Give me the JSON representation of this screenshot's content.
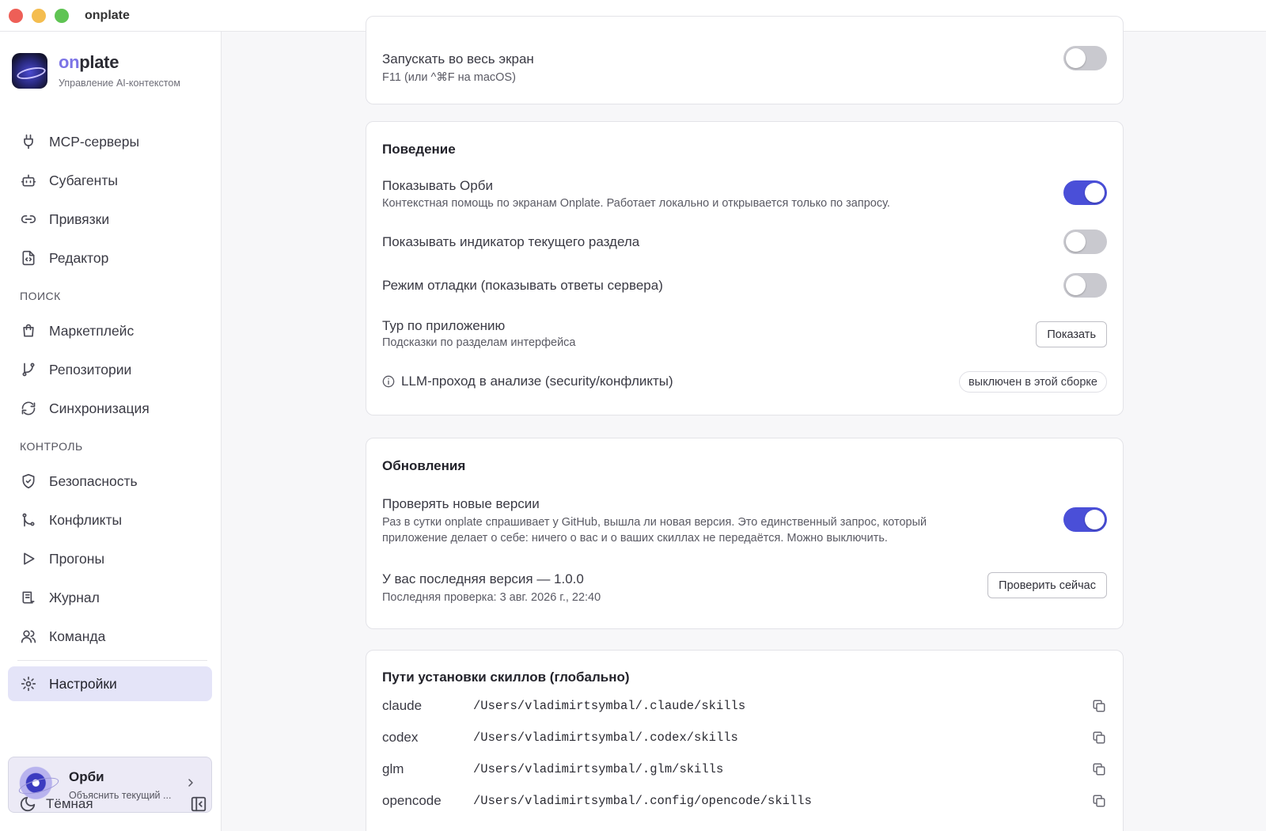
{
  "window": {
    "title": "onplate"
  },
  "brand": {
    "name_accent": "on",
    "name_rest": "plate",
    "subtitle": "Управление AI-контекстом"
  },
  "sidebar": {
    "items_top": [
      {
        "label": "MCP-серверы",
        "icon": "plug-icon"
      },
      {
        "label": "Субагенты",
        "icon": "robot-icon"
      },
      {
        "label": "Привязки",
        "icon": "link-icon"
      },
      {
        "label": "Редактор",
        "icon": "file-code-icon"
      }
    ],
    "section_search": "ПОИСК",
    "items_search": [
      {
        "label": "Маркетплейс",
        "icon": "shopping-bag-icon"
      },
      {
        "label": "Репозитории",
        "icon": "git-branch-icon"
      },
      {
        "label": "Синхронизация",
        "icon": "sync-icon"
      }
    ],
    "section_control": "КОНТРОЛЬ",
    "items_control": [
      {
        "label": "Безопасность",
        "icon": "shield-check-icon"
      },
      {
        "label": "Конфликты",
        "icon": "git-merge-icon"
      },
      {
        "label": "Прогоны",
        "icon": "play-icon"
      },
      {
        "label": "Журнал",
        "icon": "scroll-icon"
      },
      {
        "label": "Команда",
        "icon": "users-icon"
      }
    ],
    "settings_label": "Настройки",
    "orbi": {
      "title": "Орби",
      "subtitle": "Объяснить текущий ..."
    },
    "theme_label": "Тёмная"
  },
  "fullscreen": {
    "title": "Запускать во весь экран",
    "subtitle": "F11 (или ^⌘F на macOS)",
    "enabled": false
  },
  "behavior": {
    "title": "Поведение",
    "orbi_row": {
      "title": "Показывать Орби",
      "subtitle": "Контекстная помощь по экранам Onplate. Работает локально и открывается только по запросу.",
      "enabled": true
    },
    "indicator_row": {
      "title": "Показывать индикатор текущего раздела",
      "enabled": false
    },
    "debug_row": {
      "title": "Режим отладки (показывать ответы сервера)",
      "enabled": false
    },
    "tour_row": {
      "title": "Тур по приложению",
      "subtitle": "Подсказки по разделам интерфейса",
      "button": "Показать"
    },
    "llm_row": {
      "title": "LLM-проход в анализе (security/конфликты)",
      "badge": "выключен в этой сборке"
    }
  },
  "updates": {
    "title": "Обновления",
    "check_row": {
      "title": "Проверять новые версии",
      "subtitle_1": "Раз в сутки onplate спрашивает у GitHub, вышла ли новая версия. Это единственный запрос, который",
      "subtitle_2": "приложение делает о себе: ничего о вас и о ваших скиллах не передаётся. Можно выключить.",
      "enabled": true
    },
    "version_row": {
      "title": "У вас последняя версия — 1.0.0",
      "subtitle": "Последняя проверка: 3 авг. 2026 г., 22:40",
      "button": "Проверить сейчас"
    }
  },
  "paths": {
    "title": "Пути установки скиллов (глобально)",
    "rows": [
      {
        "agent": "claude",
        "path": "/Users/vladimirtsymbal/.claude/skills"
      },
      {
        "agent": "codex",
        "path": "/Users/vladimirtsymbal/.codex/skills"
      },
      {
        "agent": "glm",
        "path": "/Users/vladimirtsymbal/.glm/skills"
      },
      {
        "agent": "opencode",
        "path": "/Users/vladimirtsymbal/.config/opencode/skills"
      }
    ]
  },
  "colors": {
    "accent": "#4a4fd8",
    "active_nav_bg": "#e4e4f8",
    "toggle_off": "#c9c9cf"
  }
}
